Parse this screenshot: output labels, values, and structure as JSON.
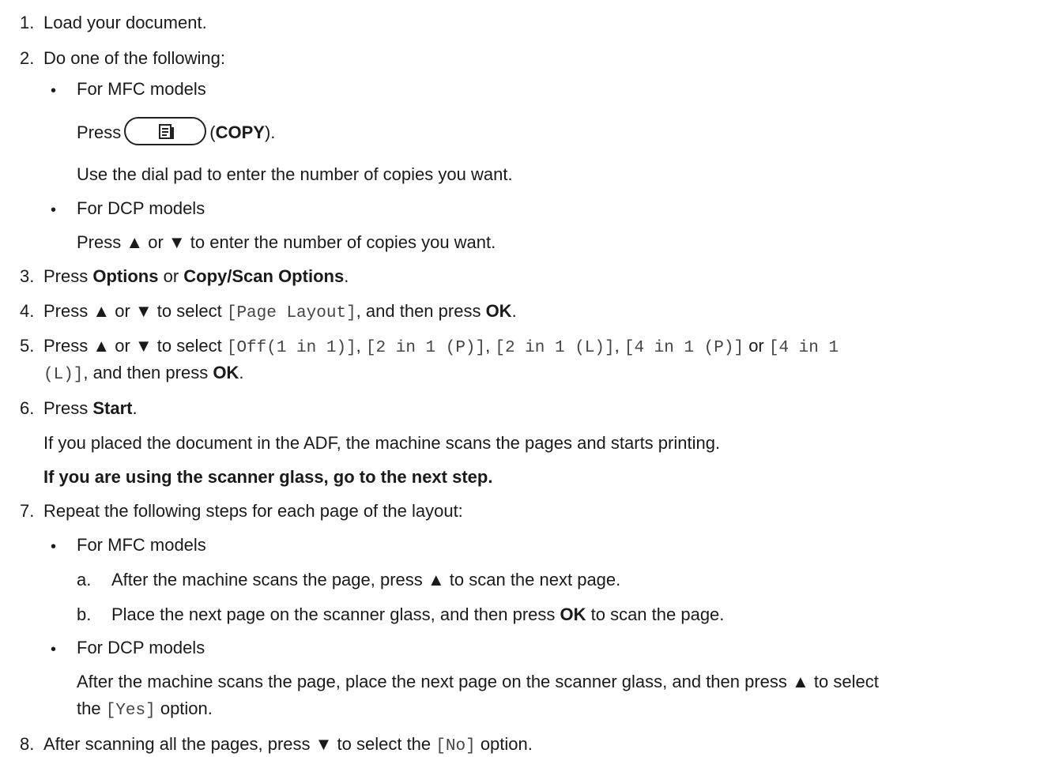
{
  "steps": {
    "s1": {
      "num": "1.",
      "text": "Load your document."
    },
    "s2": {
      "num": "2.",
      "text": "Do one of the following:",
      "mfc": {
        "title": "For MFC models",
        "press": "Press",
        "copy_icon": "copy-document-icon",
        "copy_open": "(",
        "copy_label": "COPY",
        "copy_close": ").",
        "dial": "Use the dial pad to enter the number of copies you want."
      },
      "dcp": {
        "title": "For DCP models",
        "text": "Press ▲ or ▼ to enter the number of copies you want."
      }
    },
    "s3": {
      "num": "3.",
      "pre": "Press ",
      "b1": "Options",
      "mid": " or ",
      "b2": "Copy/Scan Options",
      "post": "."
    },
    "s4": {
      "num": "4.",
      "pre": "Press ▲ or ▼ to select ",
      "code": "[Page Layout]",
      "mid": ", and then press ",
      "ok": "OK",
      "post": "."
    },
    "s5": {
      "num": "5.",
      "pre": "Press ▲ or ▼ to select ",
      "c1": "[Off(1 in 1)]",
      "sep1": ", ",
      "c2": "[2 in 1 (P)]",
      "sep2": ", ",
      "c3": "[2 in 1 (L)]",
      "sep3": ", ",
      "c4": "[4 in 1 (P)]",
      "or": " or ",
      "c5a": "[4 in 1",
      "c5b": "(L)]",
      "mid": ", and then press ",
      "ok": "OK",
      "post": "."
    },
    "s6": {
      "num": "6.",
      "pre": "Press ",
      "start": "Start",
      "post": ".",
      "adf": "If you placed the document in the ADF, the machine scans the pages and starts printing.",
      "glass": "If you are using the scanner glass, go to the next step."
    },
    "s7": {
      "num": "7.",
      "text": "Repeat the following steps for each page of the layout:",
      "mfc": {
        "title": "For MFC models",
        "a_label": "a.",
        "a_text": "After the machine scans the page, press ▲ to scan the next page.",
        "b_label": "b.",
        "b_pre": "Place the next page on the scanner glass, and then press ",
        "b_ok": "OK",
        "b_post": " to scan the page."
      },
      "dcp": {
        "title": "For DCP models",
        "line1": "After the machine scans the page, place the next page on the scanner glass, and then press ▲ to select",
        "l2_pre": "the ",
        "l2_code": "[Yes]",
        "l2_post": " option."
      }
    },
    "s8": {
      "num": "8.",
      "pre": "After scanning all the pages, press ▼ to select the ",
      "code": "[No]",
      "post": " option."
    }
  }
}
